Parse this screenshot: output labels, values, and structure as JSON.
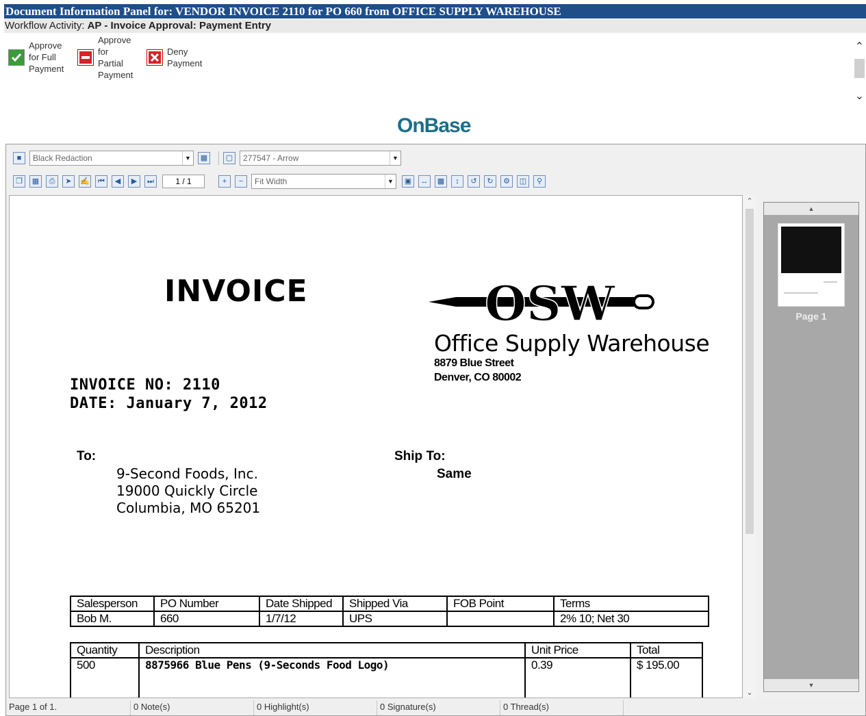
{
  "panel": {
    "title": "Document Information Panel for: VENDOR INVOICE 2110 for PO 660 from OFFICE SUPPLY WAREHOUSE",
    "workflow_label": "Workflow Activity:",
    "workflow_value": "AP - Invoice Approval: Payment Entry"
  },
  "actions": [
    {
      "label": "Approve\nfor Full\nPayment",
      "icon": "check-icon"
    },
    {
      "label": "Approve\nfor\nPartial\nPayment",
      "icon": "minus-icon"
    },
    {
      "label": "Deny\nPayment",
      "icon": "x-icon"
    }
  ],
  "brand": {
    "logo": "OnBase"
  },
  "viewer": {
    "redaction_combo": "Black Redaction",
    "annotation_combo": "277547 - Arrow",
    "page_box": "1 / 1",
    "zoom_combo": "Fit Width"
  },
  "thumbnails": [
    {
      "label": "Page 1"
    }
  ],
  "invoice": {
    "title": "INVOICE",
    "vendor_logo": "OSW",
    "vendor_name": "Office Supply Warehouse",
    "vendor_street": "8879 Blue Street",
    "vendor_city": "Denver, CO 80002",
    "invoice_no": "INVOICE NO: 2110",
    "date": "DATE: January 7, 2012",
    "to_label": "To:",
    "to_line1": "9-Second Foods, Inc.",
    "to_line2": "19000 Quickly Circle",
    "to_line3": "Columbia, MO 65201",
    "shipto_label": "Ship To:",
    "shipto_value": "Same",
    "table1": {
      "headers": [
        "Salesperson",
        "PO Number",
        "Date Shipped",
        "Shipped Via",
        "FOB Point",
        "Terms"
      ],
      "row": [
        "Bob M.",
        "660",
        "1/7/12",
        "UPS",
        "",
        "2% 10; Net 30"
      ]
    },
    "table2": {
      "headers": [
        "Quantity",
        "Description",
        "Unit Price",
        "Total"
      ],
      "row": [
        "500",
        "8875966 Blue Pens (9-Seconds Food Logo)",
        "0.39",
        "$ 195.00"
      ]
    }
  },
  "status": {
    "page": "Page 1 of 1.",
    "notes": "0 Note(s)",
    "highlights": "0 Highlight(s)",
    "signatures": "0 Signature(s)",
    "threads": "0 Thread(s)"
  }
}
